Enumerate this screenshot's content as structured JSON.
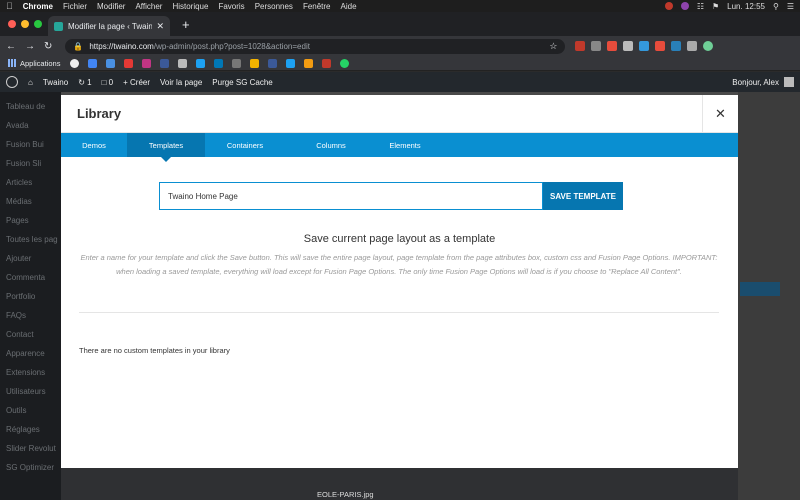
{
  "colors": {
    "accent": "#0a8fd1",
    "accent_dark": "#0676b0",
    "wp_admin_bar": "#23282d"
  },
  "macos": {
    "menus": [
      "Chrome",
      "Fichier",
      "Modifier",
      "Afficher",
      "Historique",
      "Favoris",
      "Personnes",
      "Fenêtre",
      "Aide"
    ],
    "clock": "Lun. 12:55",
    "icons": [
      "apple-icon",
      "wifi-icon",
      "flag-fr-icon",
      "search-icon",
      "menu-icon"
    ]
  },
  "browser": {
    "tab_title": "Modifier la page ‹ Twaino — W",
    "url_host": "https://twaino.com",
    "url_path": "/wp-admin/post.php?post=1028&action=edit",
    "bookmarks_label": "Applications"
  },
  "wp_admin_bar": {
    "site_name": "Twaino",
    "updates_count": "1",
    "comments_count": "0",
    "new_label": "+ Créer",
    "view_page": "Voir la page",
    "purge_cache": "Purge SG Cache",
    "greeting": "Bonjour, Alex"
  },
  "wp_sidebar": [
    "Tableau de",
    "Avada",
    "Fusion Bui",
    "Fusion Sli",
    "Articles",
    "Médias",
    "Pages",
    "Toutes les pag",
    "Ajouter",
    "Commenta",
    "Portfolio",
    "FAQs",
    "Contact",
    "Apparence",
    "Extensions",
    "Utilisateurs",
    "Outils",
    "Réglages",
    "Slider Revolut",
    "SG Optimizer"
  ],
  "bottom_filename": "EOLE-PARIS.jpg",
  "modal": {
    "title": "Library",
    "close_icon": "close-icon",
    "tabs": [
      "Demos",
      "Templates",
      "Containers",
      "Columns",
      "Elements"
    ],
    "active_tab": "Templates",
    "template_name_value": "Twaino Home Page",
    "save_button": "SAVE TEMPLATE",
    "heading": "Save current page layout as a template",
    "description": "Enter a name for your template and click the Save button. This will save the entire page layout, page template from the page attributes box, custom css and Fusion Page Options. IMPORTANT: when loading a saved template, everything will load except for Fusion Page Options. The only time Fusion Page Options will load is if you choose to \"Replace All Content\".",
    "empty_message": "There are no custom templates in your library"
  }
}
